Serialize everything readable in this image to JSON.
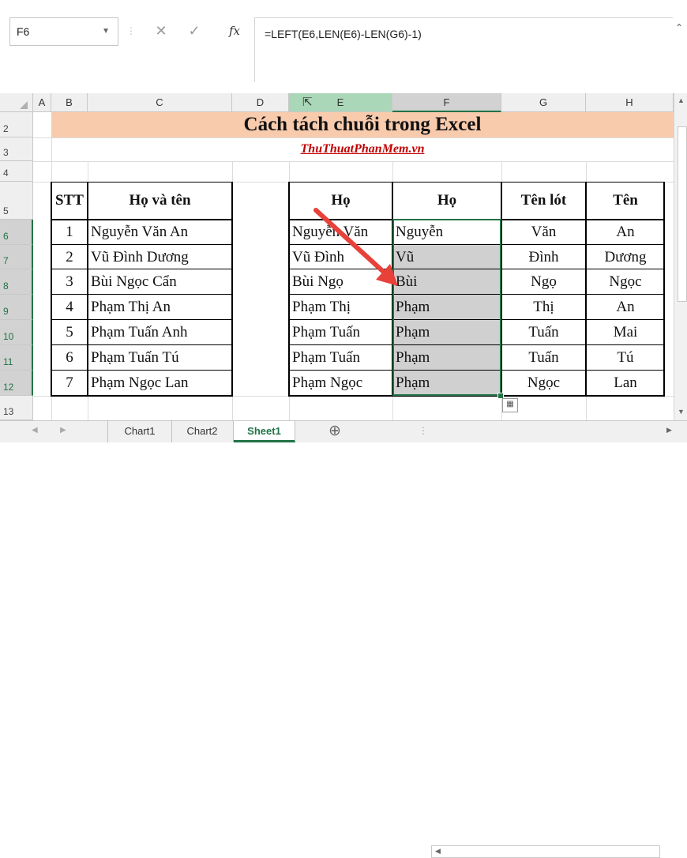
{
  "name_box": "F6",
  "formula": "=LEFT(E6,LEN(E6)-LEN(G6)-1)",
  "icons": {
    "cancel": "cancel-icon",
    "enter": "enter-icon",
    "fx": "fx-icon"
  },
  "fx_label": "fx",
  "columns": [
    "A",
    "B",
    "C",
    "D",
    "E",
    "F",
    "G",
    "H"
  ],
  "rows": [
    "2",
    "3",
    "4",
    "5",
    "6",
    "7",
    "8",
    "9",
    "10",
    "11",
    "12",
    "13"
  ],
  "title": "Cách tách chuỗi trong Excel",
  "subtitle": "ThuThuatPhanMem.vn",
  "left_table": {
    "headers": [
      "STT",
      "Họ và tên"
    ],
    "rows": [
      [
        "1",
        "Nguyễn Văn An"
      ],
      [
        "2",
        "Vũ Đình Dương"
      ],
      [
        "3",
        "Bùi Ngọc Cẩn"
      ],
      [
        "4",
        "Phạm Thị An"
      ],
      [
        "5",
        "Phạm Tuấn Anh"
      ],
      [
        "6",
        "Phạm Tuấn Tú"
      ],
      [
        "7",
        "Phạm Ngọc Lan"
      ]
    ]
  },
  "right_table": {
    "headers": [
      "Họ",
      "Họ",
      "Tên lót",
      "Tên"
    ],
    "rows": [
      [
        "Nguyễn Văn",
        "Nguyễn",
        "Văn",
        "An"
      ],
      [
        "Vũ Đình",
        "Vũ",
        "Đình",
        "Dương"
      ],
      [
        "Bùi Ngọ",
        "Bùi",
        "Ngọ",
        "Ngọc"
      ],
      [
        "Phạm Thị",
        "Phạm",
        "Thị",
        "An"
      ],
      [
        "Phạm Tuấn",
        "Phạm",
        "Tuấn",
        "Mai"
      ],
      [
        "Phạm Tuấn",
        "Phạm",
        "Tuấn",
        "Tú"
      ],
      [
        "Phạm Ngọc",
        "Phạm",
        "Ngọc",
        "Lan"
      ]
    ]
  },
  "tabs": [
    "Chart1",
    "Chart2",
    "Sheet1"
  ],
  "active_tab": "Sheet1",
  "add_sheet": "⊕",
  "colors": {
    "accent": "#217346",
    "title_band": "#f8cbad",
    "subtitle": "#c00000",
    "arrow": "#e8413a"
  }
}
